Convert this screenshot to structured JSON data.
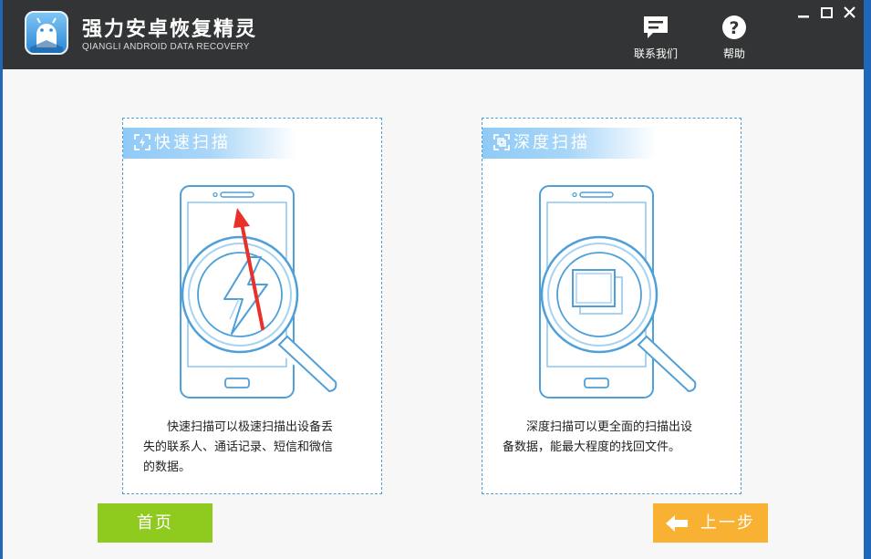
{
  "app": {
    "title": "强力安卓恢复精灵",
    "subtitle": "QIANGLI ANDROID DATA RECOVERY"
  },
  "toolbar": {
    "contact_label": "联系我们",
    "help_label": "帮助"
  },
  "window_controls": {
    "minimize": "–",
    "maximize": "□",
    "close": "×"
  },
  "cards": {
    "quick": {
      "title": "快速扫描",
      "desc_line1": "快速扫描可以极速扫描出设备丢",
      "desc_line2": "失的联系人、通话记录、短信和微信",
      "desc_line3": "的数据。",
      "icon": "lightning-icon"
    },
    "deep": {
      "title": "深度扫描",
      "desc_line1": "深度扫描可以更全面的扫描出设",
      "desc_line2": "备数据，能最大程度的找回文件。",
      "icon": "layers-icon"
    }
  },
  "nav": {
    "home_label": "首页",
    "prev_label": "上一步"
  },
  "colors": {
    "titlebar": "#333435",
    "accent_blue": "#4f9fd8",
    "home_green": "#8fca1e",
    "prev_orange": "#f8b133",
    "arrow_red": "#e8312a"
  }
}
